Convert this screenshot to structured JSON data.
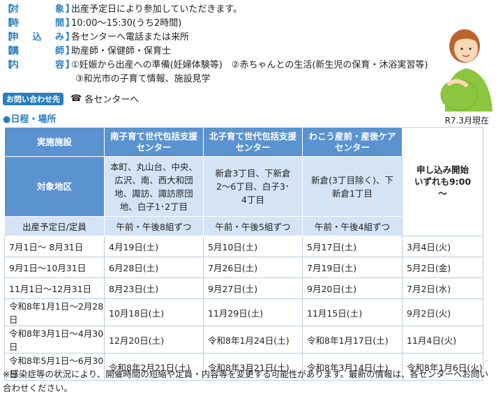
{
  "info": {
    "rows": [
      {
        "label": "対象",
        "value": "出産予定日により参加していただきます。"
      },
      {
        "label": "時間",
        "value": "10:00～15:30(うち2時間)"
      },
      {
        "label": "申込み",
        "value": "各センターへ電話または来所"
      },
      {
        "label": "講師",
        "value": "助産師・保健師・保育士"
      },
      {
        "label": "内容",
        "value": "①妊娠から出産への準備(妊婦体験等)　②赤ちゃんとの生活(新生児の保育・沐浴実習等)"
      }
    ],
    "content_line2": "③和光市の子育て情報、施設見学"
  },
  "contact": {
    "badge": "お問い合わせ先",
    "text": "各センターへ"
  },
  "schedule_title": "●日程・場所",
  "as_of": "R7.3月現在",
  "table": {
    "col_facility": "実施施設",
    "col_area": "対象地区",
    "col_date_quota": "出産予定日/定員",
    "facilities": [
      "南子育て世代包括支援センター",
      "北子育て世代包括支援センター",
      "わこう産前・産後ケアセンター"
    ],
    "areas": [
      "本町、丸山台、中央、広沢、南、西大和団地、諏訪、諏訪原団地、白子1･2丁目",
      "新倉3丁目、下新倉2～6丁目、白子3･4丁目",
      "新倉(3丁目除く)、下新倉1丁目"
    ],
    "quotas": [
      "午前・午後8組ずつ",
      "午前・午後5組ずつ",
      "午前・午後4組ずつ"
    ],
    "start_label": "申し込み開始いずれも9:00～",
    "rows": [
      [
        "7月1日～ 8月31日",
        "4月19日(土)",
        "5月10日(土)",
        "5月17日(土)",
        "3月4日(火)"
      ],
      [
        "9月1日～10月31日",
        "6月28日(土)",
        "7月26日(土)",
        "7月19日(土)",
        "5月2日(金)"
      ],
      [
        "11月1日～12月31日",
        "8月23日(土)",
        "9月27日(土)",
        "9月20日(土)",
        "7月2日(水)"
      ],
      [
        "令和8年1月1日～2月28日",
        "10月18日(土)",
        "11月29日(土)",
        "11月15日(土)",
        "9月2日(火)"
      ],
      [
        "令和8年3月1日～4月30日",
        "12月20日(土)",
        "令和8年1月24日(土)",
        "令和8年1月17日(土)",
        "11月4日(火)"
      ],
      [
        "令和8年5月1日～6月30日",
        "令和8年2月21日(土)",
        "令和8年3月21日(土)",
        "令和8年3月14日(土)",
        "令和8年1月6日(火)"
      ]
    ]
  },
  "note": "※感染症等の状況により、開催時間の短縮や定員・内容等を変更する可能性があります。最新の情報は、各センターへお問い合わせください。"
}
